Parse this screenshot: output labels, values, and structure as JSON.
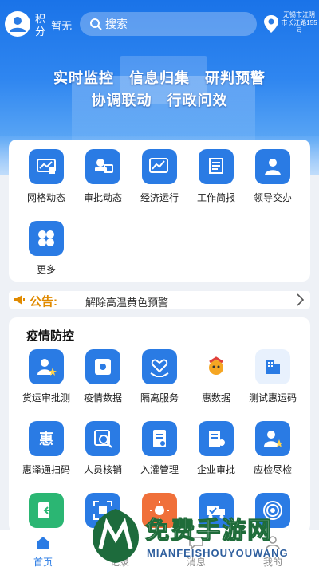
{
  "header": {
    "points_label": "积分",
    "points_value": "暂无",
    "search_placeholder": "搜索",
    "location": "无锡市江阴市长江路155号"
  },
  "banner": {
    "line1": "实时监控　信息归集　研判预警",
    "line2": "协调联动　行政问效"
  },
  "quick_menu": [
    {
      "label": "网格动态",
      "icon": "grid-monitor-icon"
    },
    {
      "label": "审批动态",
      "icon": "approval-stamp-icon"
    },
    {
      "label": "经济运行",
      "icon": "trend-chart-icon"
    },
    {
      "label": "工作简报",
      "icon": "scroll-report-icon"
    },
    {
      "label": "领导交办",
      "icon": "leader-person-icon"
    },
    {
      "label": "更多",
      "icon": "more-grid-icon"
    }
  ],
  "notice": {
    "title": "公告:",
    "text": "解除高温黄色预警"
  },
  "epidemic": {
    "title": "疫情防控",
    "items": [
      {
        "label": "货运审批测",
        "icon": "person-star-icon"
      },
      {
        "label": "疫情数据",
        "icon": "virus-data-icon"
      },
      {
        "label": "隔离服务",
        "icon": "heart-hands-icon"
      },
      {
        "label": "惠数据",
        "icon": "mascot-icon"
      },
      {
        "label": "测试惠运码",
        "icon": "building-code-icon"
      },
      {
        "label": "惠泽通扫码",
        "icon": "hui-char-icon"
      },
      {
        "label": "人员核销",
        "icon": "search-person-icon"
      },
      {
        "label": "入灌管理",
        "icon": "document-icon"
      },
      {
        "label": "企业审批",
        "icon": "enterprise-icon"
      },
      {
        "label": "应检尽检",
        "icon": "person-star-icon"
      },
      {
        "label": "",
        "icon": "exit-door-icon"
      },
      {
        "label": "",
        "icon": "scan-frame-icon"
      },
      {
        "label": "",
        "icon": "sun-icon"
      },
      {
        "label": "",
        "icon": "truck-check-icon"
      },
      {
        "label": "",
        "icon": "signal-icon"
      }
    ]
  },
  "tabbar": [
    {
      "label": "首页",
      "icon": "home-icon",
      "active": true
    },
    {
      "label": "记录",
      "icon": "record-icon",
      "active": false
    },
    {
      "label": "消息",
      "icon": "message-icon",
      "active": false
    },
    {
      "label": "我的",
      "icon": "user-icon",
      "active": false
    }
  ],
  "watermark": {
    "title": "免费手游网",
    "subtitle": "MIANFEISHOUYOUWANG"
  },
  "colors": {
    "primary": "#2a7be4",
    "notice": "#e08a00",
    "hero_top": "#1a73e8"
  }
}
